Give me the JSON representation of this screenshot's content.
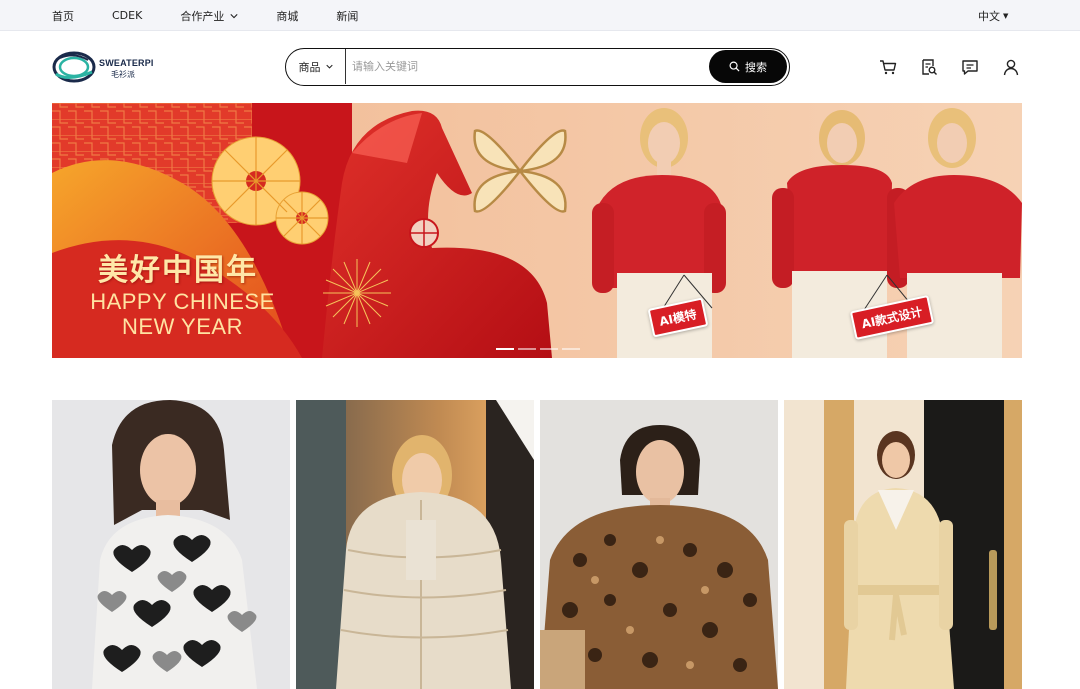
{
  "topbar": {
    "nav": [
      {
        "label": "首页"
      },
      {
        "label": "CDEK"
      },
      {
        "label": "合作产业",
        "has_dropdown": true
      },
      {
        "label": "商城"
      },
      {
        "label": "新闻"
      }
    ],
    "language": "中文"
  },
  "header": {
    "logo": {
      "line1": "SWEATERPI",
      "line2": "毛衫派"
    },
    "search": {
      "category": "商品",
      "placeholder": "请输入关键词",
      "button_label": "搜索"
    },
    "icons": [
      "cart-icon",
      "order-search-icon",
      "message-icon",
      "user-icon"
    ]
  },
  "banner": {
    "title_cn": "美好中国年",
    "title_en_1": "HAPPY CHINESE",
    "title_en_2": "NEW YEAR",
    "tag_1": "AI模特",
    "tag_2": "AI款式设计",
    "slides": 4,
    "active_slide": 1
  },
  "products": [
    {
      "description": "heart-pattern-sweater"
    },
    {
      "description": "cream-puffer-jacket"
    },
    {
      "description": "leopard-fur-coat"
    },
    {
      "description": "camel-belted-coat"
    }
  ],
  "colors": {
    "accent": "#070707",
    "topbar_bg": "#f4f5f9",
    "banner_red": "#d81e25",
    "banner_peach": "#f3c9a8"
  }
}
